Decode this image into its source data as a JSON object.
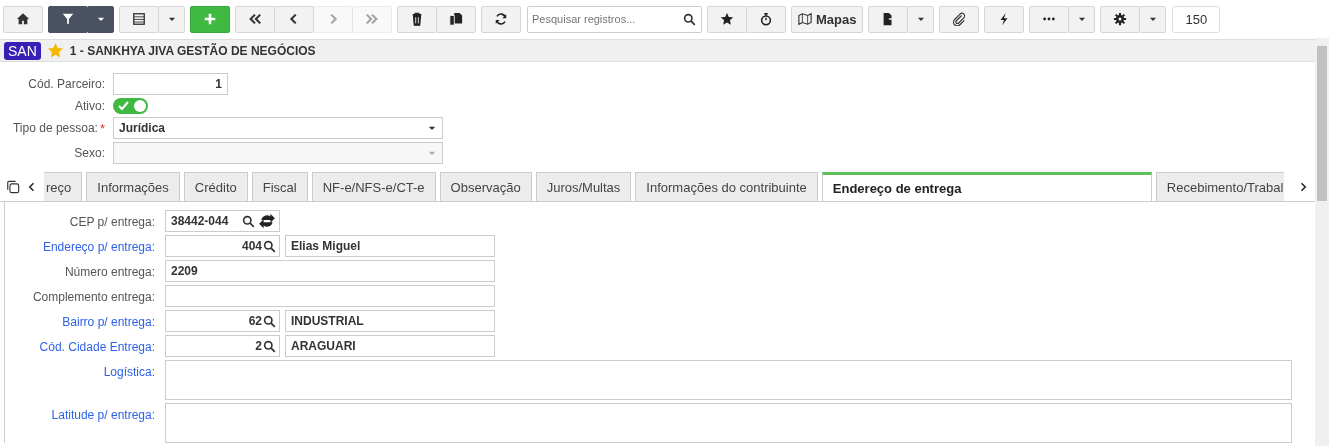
{
  "toolbar": {
    "filter_active": true,
    "navigation": [
      {
        "disabled": false
      },
      {
        "disabled": false
      },
      {
        "disabled": true
      },
      {
        "disabled": true
      }
    ],
    "search": {
      "placeholder": "Pesquisar registros..."
    },
    "maps_label": "Mapas",
    "record_count": "150"
  },
  "header": {
    "badge": "SAN",
    "favorite": true,
    "title": "1 - SANKHYA JIVA GESTÃO DE NEGÓCIOS"
  },
  "master_fields": [
    {
      "kind": "number",
      "label": "Cód. Parceiro:",
      "value": "1"
    },
    {
      "kind": "toggle",
      "label": "Ativo:",
      "on": true
    },
    {
      "kind": "select",
      "label": "Tipo de pessoa:",
      "required_mark": "*",
      "value": "Jurídica",
      "disabled": false
    },
    {
      "kind": "select",
      "label": "Sexo:",
      "disabled": true
    }
  ],
  "tabs": [
    {
      "label": "reço",
      "selected": false
    },
    {
      "label": "Informações",
      "selected": false
    },
    {
      "label": "Crédito",
      "selected": false
    },
    {
      "label": "Fiscal",
      "selected": false
    },
    {
      "label": "NF-e/NFS-e/CT-e",
      "selected": false
    },
    {
      "label": "Observação",
      "selected": false
    },
    {
      "label": "Juros/Multas",
      "selected": false
    },
    {
      "label": "Informações do contribuinte",
      "selected": false
    },
    {
      "label": "Endereço de entrega",
      "selected": true
    },
    {
      "label": "Recebimento/Trabal",
      "selected": false
    }
  ],
  "fields": [
    {
      "kind": "cep",
      "label": "CEP p/ entrega:",
      "value": "38442-044"
    },
    {
      "kind": "lookup",
      "label": "Endereço p/ entrega:",
      "code": "404",
      "description": "Elias Miguel"
    },
    {
      "kind": "text",
      "label": "Número entrega:",
      "value": "2209"
    },
    {
      "kind": "text",
      "label": "Complemento entrega:"
    },
    {
      "kind": "lookup",
      "label": "Bairro p/ entrega:",
      "code": "62",
      "description": "INDUSTRIAL"
    },
    {
      "kind": "lookup",
      "label": "Cód. Cidade Entrega:",
      "code": "2",
      "description": "ARAGUARI"
    },
    {
      "kind": "textarea",
      "label": "Logística:",
      "link": true
    },
    {
      "kind": "textarea",
      "label": "Latitude p/ entrega:",
      "link": true
    }
  ]
}
